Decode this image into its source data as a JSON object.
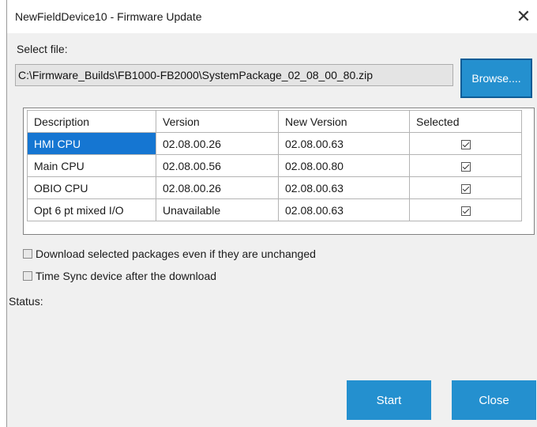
{
  "window": {
    "title": "NewFieldDevice10 -  Firmware Update",
    "close_glyph": "✕",
    "close_icon": "close-icon"
  },
  "file": {
    "label": "Select file:",
    "path": "C:\\Firmware_Builds\\FB1000-FB2000\\SystemPackage_02_08_00_80.zip",
    "browse_label": "Browse...."
  },
  "table": {
    "columns": [
      "Description",
      "Version",
      "New Version",
      "Selected"
    ],
    "rows": [
      {
        "description": "HMI CPU",
        "version": "02.08.00.26",
        "new_version": "02.08.00.63",
        "selected": true
      },
      {
        "description": "Main CPU",
        "version": "02.08.00.56",
        "new_version": "02.08.00.80",
        "selected": true
      },
      {
        "description": "OBIO CPU",
        "version": "02.08.00.26",
        "new_version": "02.08.00.63",
        "selected": true
      },
      {
        "description": "Opt 6 pt mixed I/O",
        "version": "Unavailable",
        "new_version": "02.08.00.63",
        "selected": true
      }
    ],
    "highlighted_row": 0
  },
  "options": {
    "download_unchanged": {
      "label": "Download selected packages even if they are unchanged",
      "checked": false
    },
    "time_sync": {
      "label": "Time Sync device after the download",
      "checked": false
    }
  },
  "status": {
    "label": "Status:"
  },
  "buttons": {
    "start_label": "Start",
    "close_label": "Close"
  },
  "colors": {
    "accent": "#2490cf",
    "selection": "#1576d2"
  }
}
